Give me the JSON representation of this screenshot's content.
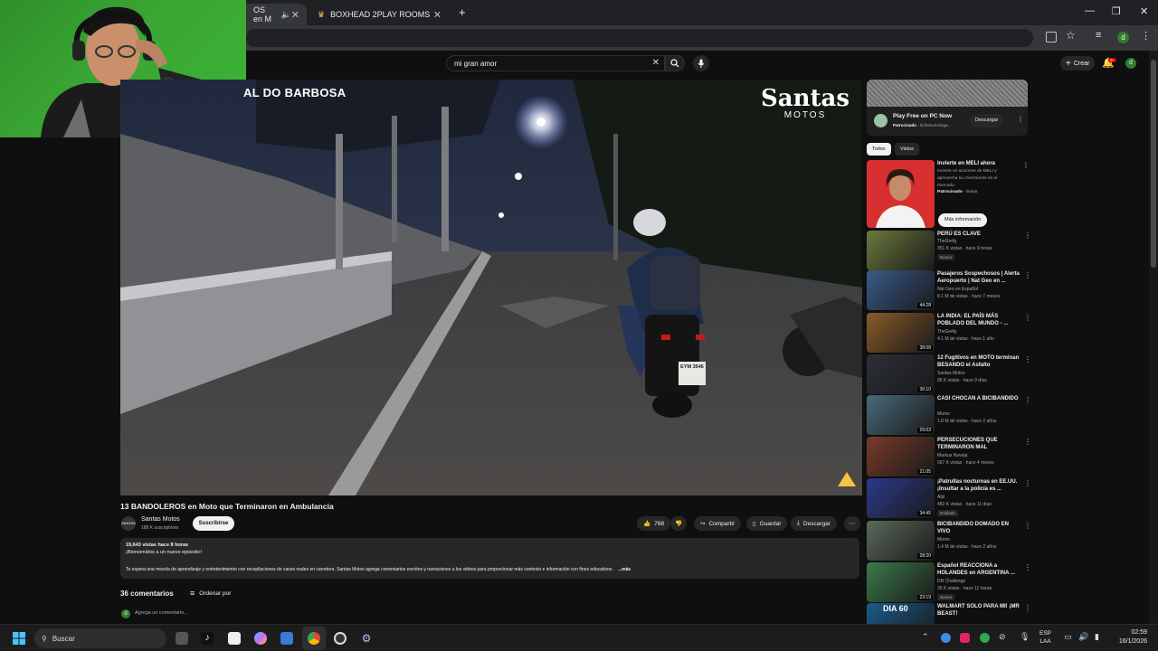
{
  "browser": {
    "tabs": [
      {
        "label": "OS en M",
        "active": true
      },
      {
        "label": "BOXHEAD 2PLAY ROOMS jueg",
        "active": false
      }
    ],
    "new_tab": "+"
  },
  "youtube": {
    "search": {
      "value": "mi gran amor"
    },
    "create_label": "Crear",
    "notif_count": "9+",
    "avatar_letter": "d"
  },
  "video": {
    "overlay_title": "AL DO BARBOSA",
    "logo_main": "Santas",
    "logo_sub": "MOTOS",
    "plate": "EYM 3546"
  },
  "meta": {
    "title": "13 BANDOLEROS en Moto que Terminaron en Ambulancia",
    "channel": "Santas Motos",
    "subs": "188 K suscriptores",
    "subscribe": "Suscribirse",
    "likes": "768",
    "share": "Compartir",
    "save": "Guardar",
    "download": "Descargar",
    "views_line": "19,643 vistas  hace 8 horas",
    "welcome": "¡Bienvenidos a un nuevo episodio!",
    "desc": "Te espera una mezcla de aprendizaje y entretenimiento con recopilaciones de casos reales en carretera. Santas Motos agrega comentarios escritos y narraciones a los videos para proporcionar más contexto e información con fines educativos.",
    "more": "...más",
    "comments_count": "36 comentarios",
    "sort": "Ordenar por",
    "add_comment": "Agrega un comentario..."
  },
  "sidebar": {
    "ad": {
      "title": "Play Free on PC Now",
      "sponsor": "Patrocinado",
      "domain": "ld.thesunrisega...",
      "cta": "Descargar"
    },
    "chips": [
      "Todos",
      "Vistos"
    ],
    "promo": {
      "title": "Invierte en MELI ahora",
      "desc": "Invierte en acciones de MELI y aprovecha su crecimiento en el mercado.",
      "sponsor": "Patrocinado",
      "advertiser": "Banjo",
      "cta": "Más información"
    },
    "recs": [
      {
        "title": "PERÚ ES CLAVE",
        "channel": "TheGrefg",
        "meta": "351 K vistas · hace 9 horas",
        "badge": "Nuevo",
        "duration": "",
        "color": "#6b7a3b"
      },
      {
        "title": "Pasajeros Sospechosos | Alerta Aeropuerto | Nat Geo en ...",
        "channel": "Nat Geo en Español",
        "meta": "8.1 M de vistas · hace 7 meses",
        "badge": "",
        "duration": "44:28",
        "color": "#3a5a8a"
      },
      {
        "title": "LA INDIA: EL PAÍS MÁS POBLADO DEL MUNDO - ...",
        "channel": "TheGrefg",
        "meta": "4.1 M de vistas · hace 1 año",
        "badge": "",
        "duration": "38:08",
        "color": "#8a5a2a"
      },
      {
        "title": "12 Fugitivos en MOTO terminan BESANDO el Asfalto",
        "channel": "Santas Motos",
        "meta": "95 K vistas · hace 9 días",
        "badge": "",
        "duration": "30:10",
        "color": "#2c2f3a"
      },
      {
        "title": "CASI CHOCAN A BICIBANDIDO",
        "channel": "Momo",
        "meta": "1.8 M de vistas · hace 2 años",
        "badge": "",
        "duration": "29:03",
        "color": "#4a6a7a"
      },
      {
        "title": "PERSECUCIONES QUE TERMINARON MAL",
        "channel": "Markus Naveja",
        "meta": "567 K vistas · hace 4 meses",
        "badge": "",
        "duration": "21:05",
        "color": "#7a3a2a"
      },
      {
        "title": "¡Patrullas nocturnas en EE.UU. ¡Insultar a la policía es ...",
        "channel": "Alpi",
        "meta": "482 K vistas · hace 11 días",
        "badge": "Doblado",
        "duration": "34:45",
        "color": "#2a3a8a"
      },
      {
        "title": "BICIBANDIDO DOMADO EN VIVO",
        "channel": "Momo",
        "meta": "1.4 M de vistas · hace 2 años",
        "badge": "",
        "duration": "28:20",
        "color": "#5a6a5a"
      },
      {
        "title": "Español REACCIONA a HOLANDES en ARGENTINA ...",
        "channel": "DN Challenge",
        "meta": "35 K vistas · hace 11 horas",
        "badge": "Nuevo",
        "duration": "23:19",
        "color": "#3a7a4a"
      },
      {
        "title": "WALMART SOLO PARA MI! ¡MR BEAST!",
        "channel": "",
        "meta": "",
        "badge": "",
        "duration": "",
        "color": "#1a5a8a"
      }
    ],
    "dia60": "DIA 60"
  },
  "taskbar": {
    "search": "Buscar",
    "lang1": "ESP",
    "lang2": "LAA",
    "time": "02:59",
    "date": "16/1/2026"
  }
}
